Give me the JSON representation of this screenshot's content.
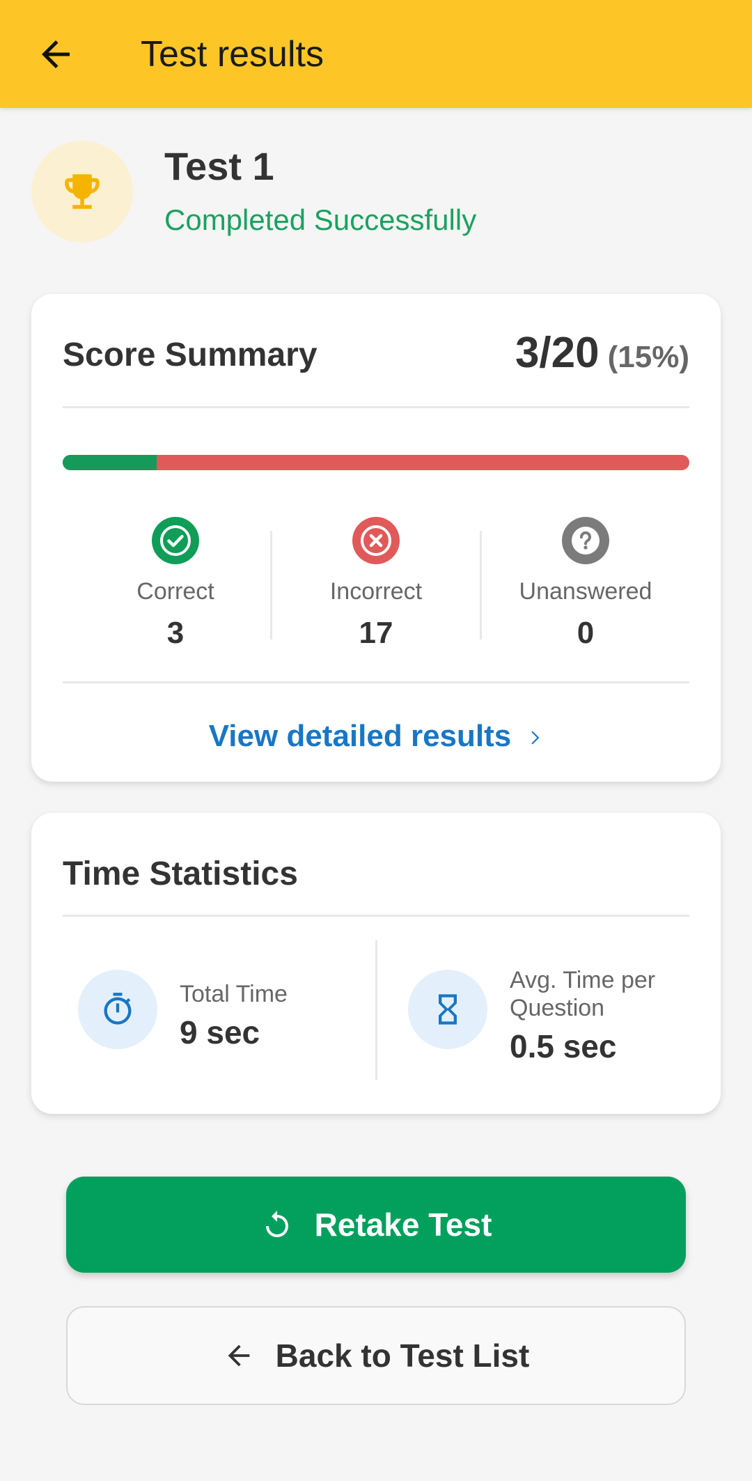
{
  "app_bar": {
    "title": "Test results",
    "background": "#fdc626"
  },
  "test": {
    "name": "Test 1",
    "status": "Completed Successfully",
    "status_color": "#1aa260",
    "icon": "trophy-icon"
  },
  "score_summary": {
    "title": "Score Summary",
    "score": "3/20",
    "percent": "(15%)",
    "progress_fraction": 0.15,
    "stats": [
      {
        "label": "Correct",
        "value": "3",
        "icon": "check-circle-icon",
        "color": "#0f9d58"
      },
      {
        "label": "Incorrect",
        "value": "17",
        "icon": "cross-circle-icon",
        "color": "#e05a5a"
      },
      {
        "label": "Unanswered",
        "value": "0",
        "icon": "question-circle-icon",
        "color": "#7b7b7b"
      }
    ],
    "link_label": "View detailed results",
    "link_color": "#1976c5"
  },
  "time_statistics": {
    "title": "Time Statistics",
    "total": {
      "label": "Total Time",
      "value": "9 sec",
      "icon": "stopwatch-icon"
    },
    "average": {
      "label_line1": "Avg. Time per",
      "label_line2": "Question",
      "value": "0.5 sec",
      "icon": "hourglass-icon"
    }
  },
  "actions": {
    "retake_label": "Retake Test",
    "retake_color": "#03a05d",
    "back_label": "Back to Test List"
  }
}
